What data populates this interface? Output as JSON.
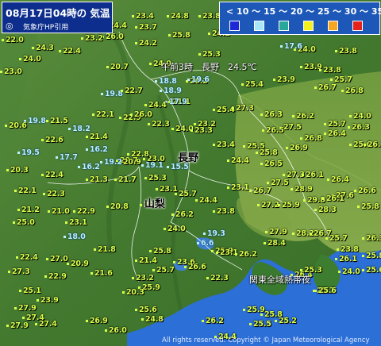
{
  "header": {
    "title": "08月17日04時の 気温",
    "source": "気象庁HP引用"
  },
  "legend": {
    "scale_label": "< 10 ～ 15 ～ 20 ～ 25 ～ 30 ～ 35 ≤ (℃)",
    "colors": [
      "#1d2ad6",
      "#a8e6f8",
      "#2aa79b",
      "#f4ef1f",
      "#f5a623",
      "#e6231a"
    ]
  },
  "labels": {
    "nagano_pref": "長野",
    "yamanashi_pref": "山梨",
    "nagano_note": "午前3時　長野　24.5℃",
    "kanto_note": "関東全域熱帯夜"
  },
  "copyright": "All rights reserved. Copyright © Japan Meteorological Agency",
  "stations": [
    {
      "t": "24.5",
      "c": "warm"
    },
    {
      "t": "23.4",
      "c": "warm"
    },
    {
      "t": "24.8",
      "c": "warm"
    },
    {
      "t": "23.8",
      "c": "warm"
    },
    {
      "t": "23.7",
      "c": "warm"
    },
    {
      "t": "24.4",
      "c": "warm"
    },
    {
      "t": "23.7",
      "c": "warm"
    },
    {
      "t": "26.0",
      "c": "warm"
    },
    {
      "t": "25.8",
      "c": "warm"
    },
    {
      "t": "24.1",
      "c": "warm"
    },
    {
      "t": "23.6",
      "c": "warm"
    },
    {
      "t": "23.2",
      "c": "warm"
    },
    {
      "t": "22.0",
      "c": "warm"
    },
    {
      "t": "24.3",
      "c": "warm"
    },
    {
      "t": "24.2",
      "c": "warm"
    },
    {
      "t": "24.0",
      "c": "warm"
    },
    {
      "t": "22.4",
      "c": "warm"
    },
    {
      "t": "25.3",
      "c": "warm"
    },
    {
      "t": "17.6",
      "c": "cool"
    },
    {
      "t": "23.8",
      "c": "warm"
    },
    {
      "t": "24.0",
      "c": "warm"
    },
    {
      "t": "24.0",
      "c": "warm"
    },
    {
      "t": "20.7",
      "c": "warm"
    },
    {
      "t": "18.8",
      "c": "cool"
    },
    {
      "t": "23.9",
      "c": "warm"
    },
    {
      "t": "23.8",
      "c": "warm"
    },
    {
      "t": "23.0",
      "c": "warm"
    },
    {
      "t": "23.9",
      "c": "warm"
    },
    {
      "t": "25.7",
      "c": "warm"
    },
    {
      "t": "26.2",
      "c": "warm"
    },
    {
      "t": "25.4",
      "c": "warm"
    },
    {
      "t": "19.8",
      "c": "cool"
    },
    {
      "t": "22.7",
      "c": "warm"
    },
    {
      "t": "18.9",
      "c": "cool"
    },
    {
      "t": "19.6",
      "c": "cool"
    },
    {
      "t": "26.7",
      "c": "warm"
    },
    {
      "t": "21.1",
      "c": "warm"
    },
    {
      "t": "17.9",
      "c": "cool"
    },
    {
      "t": "24.4",
      "c": "warm"
    },
    {
      "t": "26.8",
      "c": "warm"
    },
    {
      "t": "24.0",
      "c": "warm"
    },
    {
      "t": "25.4",
      "c": "warm"
    },
    {
      "t": "27.3",
      "c": "warm"
    },
    {
      "t": "26.3",
      "c": "warm"
    },
    {
      "t": "26.2",
      "c": "warm"
    },
    {
      "t": "19.8",
      "c": "cool"
    },
    {
      "t": "21.5",
      "c": "warm"
    },
    {
      "t": "22.1",
      "c": "warm"
    },
    {
      "t": "20.6",
      "c": "warm"
    },
    {
      "t": "22.9",
      "c": "warm"
    },
    {
      "t": "22.3",
      "c": "warm"
    },
    {
      "t": "23.2",
      "c": "warm"
    },
    {
      "t": "26.0",
      "c": "warm"
    },
    {
      "t": "18.2",
      "c": "cool"
    },
    {
      "t": "24.0",
      "c": "warm"
    },
    {
      "t": "23.3",
      "c": "warm"
    },
    {
      "t": "26.3",
      "c": "warm"
    },
    {
      "t": "27.5",
      "c": "warm"
    },
    {
      "t": "26.5",
      "c": "warm"
    },
    {
      "t": "25.7",
      "c": "warm"
    },
    {
      "t": "22.6",
      "c": "warm"
    },
    {
      "t": "21.4",
      "c": "warm"
    },
    {
      "t": "26.8",
      "c": "warm"
    },
    {
      "t": "26.4",
      "c": "warm"
    },
    {
      "t": "23.4",
      "c": "warm"
    },
    {
      "t": "25.5",
      "c": "warm"
    },
    {
      "t": "26.9",
      "c": "warm"
    },
    {
      "t": "25.6",
      "c": "warm"
    },
    {
      "t": "19.5",
      "c": "cool"
    },
    {
      "t": "16.2",
      "c": "cool"
    },
    {
      "t": "25.8",
      "c": "warm"
    },
    {
      "t": "20.7",
      "c": "warm"
    },
    {
      "t": "23.0",
      "c": "warm"
    },
    {
      "t": "26.1",
      "c": "warm"
    },
    {
      "t": "17.7",
      "c": "cool"
    },
    {
      "t": "22.8",
      "c": "warm"
    },
    {
      "t": "20.9",
      "c": "warm"
    },
    {
      "t": "19.2",
      "c": "cool"
    },
    {
      "t": "19.1",
      "c": "cool"
    },
    {
      "t": "15.5",
      "c": "cool"
    },
    {
      "t": "24.4",
      "c": "warm"
    },
    {
      "t": "26.5",
      "c": "warm"
    },
    {
      "t": "16.2",
      "c": "cool"
    },
    {
      "t": "20.3",
      "c": "warm"
    },
    {
      "t": "27.3",
      "c": "warm"
    },
    {
      "t": "26.1",
      "c": "warm"
    },
    {
      "t": "22.4",
      "c": "warm"
    },
    {
      "t": "21.3",
      "c": "warm"
    },
    {
      "t": "21.7",
      "c": "warm"
    },
    {
      "t": "26.4",
      "c": "warm"
    },
    {
      "t": "27.5",
      "c": "warm"
    },
    {
      "t": "25.3",
      "c": "warm"
    },
    {
      "t": "22.1",
      "c": "warm"
    },
    {
      "t": "22.3",
      "c": "warm"
    },
    {
      "t": "23.1",
      "c": "warm"
    },
    {
      "t": "26.7",
      "c": "warm"
    },
    {
      "t": "28.9",
      "c": "warm"
    },
    {
      "t": "27.6",
      "c": "warm"
    },
    {
      "t": "26.6",
      "c": "warm"
    },
    {
      "t": "21.2",
      "c": "warm"
    },
    {
      "t": "21.0",
      "c": "warm"
    },
    {
      "t": "25.7",
      "c": "warm"
    },
    {
      "t": "24.4",
      "c": "warm"
    },
    {
      "t": "29.8",
      "c": "warm"
    },
    {
      "t": "28.3",
      "c": "warm"
    },
    {
      "t": "22.9",
      "c": "warm"
    },
    {
      "t": "20.8",
      "c": "warm"
    },
    {
      "t": "22.8",
      "c": "warm"
    },
    {
      "t": "27.2",
      "c": "warm"
    },
    {
      "t": "25.9",
      "c": "warm"
    },
    {
      "t": "25.8",
      "c": "warm"
    },
    {
      "t": "26.1",
      "c": "warm"
    },
    {
      "t": "23.1",
      "c": "warm"
    },
    {
      "t": "23.8",
      "c": "warm"
    },
    {
      "t": "26.2",
      "c": "warm"
    },
    {
      "t": "25.0",
      "c": "warm"
    },
    {
      "t": "23.1",
      "c": "warm"
    },
    {
      "t": "24.0",
      "c": "warm"
    },
    {
      "t": "27.9",
      "c": "warm"
    },
    {
      "t": "28.2",
      "c": "warm"
    },
    {
      "t": "26.7",
      "c": "warm"
    },
    {
      "t": "19.3",
      "c": "cool"
    },
    {
      "t": "25.7",
      "c": "warm"
    },
    {
      "t": "26.3",
      "c": "warm"
    },
    {
      "t": "18.0",
      "c": "cool"
    },
    {
      "t": "6.6",
      "c": "cool"
    },
    {
      "t": "28.4",
      "c": "warm"
    },
    {
      "t": "23.8",
      "c": "warm"
    },
    {
      "t": "25.9",
      "c": "warm"
    },
    {
      "t": "21.8",
      "c": "warm"
    },
    {
      "t": "25.8",
      "c": "warm"
    },
    {
      "t": "23.1",
      "c": "warm"
    },
    {
      "t": "26.1",
      "c": "warm"
    },
    {
      "t": "22.4",
      "c": "warm"
    },
    {
      "t": "27.0",
      "c": "warm"
    },
    {
      "t": "20.9",
      "c": "warm"
    },
    {
      "t": "21.4",
      "c": "warm"
    },
    {
      "t": "23.6",
      "c": "warm"
    },
    {
      "t": "26.2",
      "c": "warm"
    },
    {
      "t": "25.8",
      "c": "warm"
    },
    {
      "t": "27.3",
      "c": "warm"
    },
    {
      "t": "23.2",
      "c": "warm"
    },
    {
      "t": "24.0",
      "c": "warm"
    },
    {
      "t": "22.3",
      "c": "warm"
    },
    {
      "t": "26.4",
      "c": "warm"
    },
    {
      "t": "25.3",
      "c": "warm"
    },
    {
      "t": "25.1",
      "c": "warm"
    },
    {
      "t": "23.9",
      "c": "warm"
    },
    {
      "t": "25.9",
      "c": "warm"
    },
    {
      "t": "25.7",
      "c": "warm"
    },
    {
      "t": "27.9",
      "c": "warm"
    },
    {
      "t": "25.6",
      "c": "warm"
    },
    {
      "t": "27.4",
      "c": "warm"
    },
    {
      "t": "25.6",
      "c": "warm"
    },
    {
      "t": "25.9",
      "c": "warm"
    },
    {
      "t": "27.9",
      "c": "warm"
    },
    {
      "t": "27.4",
      "c": "warm"
    },
    {
      "t": "26.9",
      "c": "warm"
    },
    {
      "t": "26.0",
      "c": "warm"
    },
    {
      "t": "24.8",
      "c": "warm"
    },
    {
      "t": "25.2",
      "c": "warm"
    },
    {
      "t": "25.8",
      "c": "warm"
    },
    {
      "t": "26.2",
      "c": "warm"
    },
    {
      "t": "25.5",
      "c": "warm"
    },
    {
      "t": "24.4",
      "c": "warm"
    },
    {
      "t": "26.6",
      "c": "warm"
    },
    {
      "t": "25.7",
      "c": "warm"
    },
    {
      "t": "25.6",
      "c": "warm"
    },
    {
      "t": "22.9",
      "c": "warm"
    },
    {
      "t": "21.6",
      "c": "warm"
    },
    {
      "t": "20.3",
      "c": "warm"
    }
  ]
}
